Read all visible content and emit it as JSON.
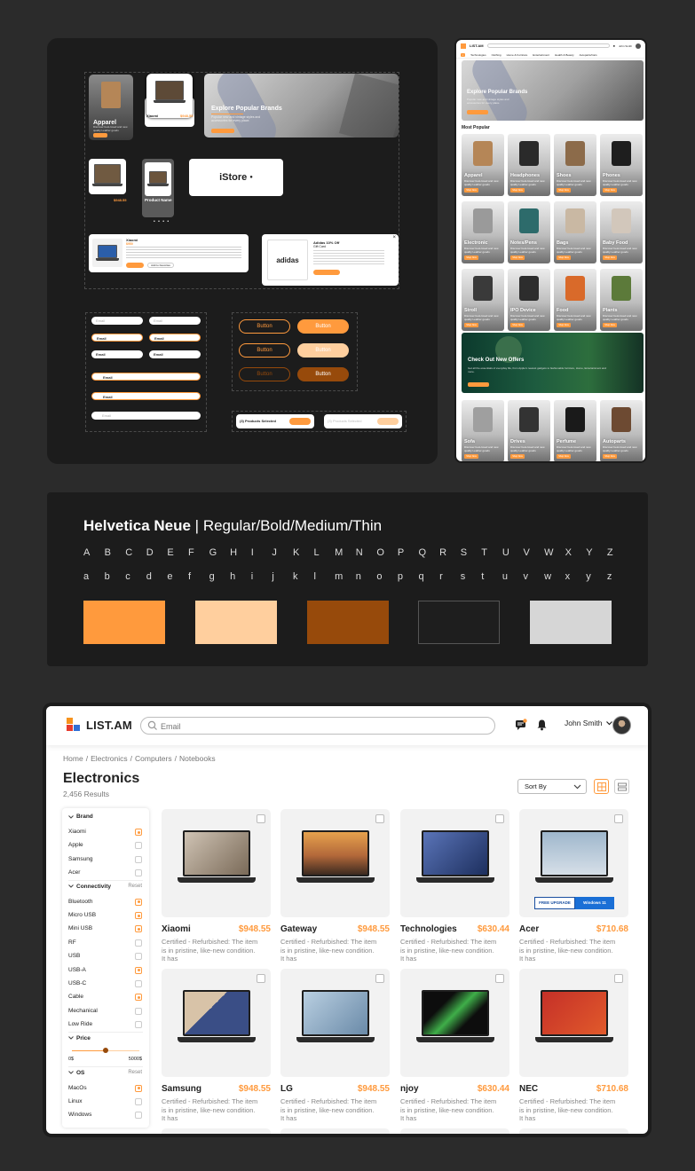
{
  "board": {
    "apparel_title": "Apparel",
    "apparel_sub": "Discover best-loved and new quality Leather goods",
    "xiaomi_label": "Xiaomi",
    "xiaomi_price": "$948.55",
    "hero_title": "Explore Popular Brands",
    "hero_sub": "Popular new and vintage styles and accessories for every place.",
    "product_price": "$948.55",
    "product_name_label": "Product Name",
    "istore_logo": "iStore",
    "promo_brand": "Xiaomi",
    "promo_price": "$950",
    "promo_add": "Add to Favorites",
    "adidas_title": "Adidas 10% Off",
    "adidas_sub": "Gift Card",
    "adidas_logo": "adidas",
    "inputs": {
      "email_placeholder": "Email",
      "email_value": "Email"
    },
    "button_label": "Button",
    "products_selected": "(3) Products Selected",
    "products_selected_grey": "(3) Products Selected"
  },
  "preview": {
    "logo": "LIST.AM",
    "user": "John Smith",
    "nav": [
      "Technologies",
      "Clothing",
      "Home & Furniture",
      "Entertainment",
      "Health & Beauty",
      "Autoparts/Cars"
    ],
    "hero_title": "Explore Popular Brands",
    "hero_sub": "Popular new and vintage styles and accessories for every place.",
    "most_popular": "Most Popular",
    "card_sub": "Discover best-loved and new quality Leather goods",
    "card_btn": "Shop Now",
    "cards": [
      "Apparel",
      "Headphones",
      "Shoes",
      "Phones",
      "Electronic",
      "Notes/Pens",
      "Bags",
      "Baby Food",
      "Stroll",
      "IPO Device",
      "Food",
      "Plants",
      "Sofa",
      "Drives",
      "Perfume",
      "Autoparts"
    ],
    "offer_title": "Check Out  New Offers",
    "offer_sub": "Get all the essentials of everyday life, from Apple's newest gadgets to fashionable furniture, Home, Entertainment and more.",
    "offer_btn": "Shop Now"
  },
  "typography": {
    "font_name": "Helvetica Neue",
    "weights": " | Regular/Bold/Medium/Thin",
    "upper": [
      "A",
      "B",
      "C",
      "D",
      "E",
      "F",
      "G",
      "H",
      "I",
      "J",
      "K",
      "L",
      "M",
      "N",
      "O",
      "P",
      "Q",
      "R",
      "S",
      "T",
      "U",
      "V",
      "W",
      "X",
      "Y",
      "Z"
    ],
    "lower": [
      "a",
      "b",
      "c",
      "d",
      "e",
      "f",
      "g",
      "h",
      "i",
      "j",
      "k",
      "l",
      "m",
      "n",
      "o",
      "p",
      "q",
      "r",
      "s",
      "t",
      "u",
      "v",
      "w",
      "x",
      "y",
      "z"
    ],
    "palette": [
      "#ff9a3d",
      "#ffcf9e",
      "#974a0b",
      "#1e1e1e",
      "#d6d6d6"
    ]
  },
  "app": {
    "logo": "LIST.AM",
    "search_placeholder": "Email",
    "user_name": "John Smith",
    "breadcrumbs": [
      "Home",
      "Electronics",
      "Computers",
      "Notebooks"
    ],
    "title": "Electronics",
    "results": "2,456 Results",
    "sort_label": "Sort By",
    "filters": {
      "brand_label": "Brand",
      "brands": [
        {
          "name": "Xiaomi",
          "checked": true
        },
        {
          "name": "Apple",
          "checked": false
        },
        {
          "name": "Samsung",
          "checked": false
        },
        {
          "name": "Acer",
          "checked": false
        }
      ],
      "connectivity_label": "Connectivity",
      "reset": "Reset",
      "connectivity": [
        {
          "name": "Bluetooth",
          "checked": true
        },
        {
          "name": "Micro USB",
          "checked": true
        },
        {
          "name": "Mini USB",
          "checked": true
        },
        {
          "name": "RF",
          "checked": false
        },
        {
          "name": "USB",
          "checked": false
        },
        {
          "name": "USB-A",
          "checked": true
        },
        {
          "name": "USB-C",
          "checked": false
        },
        {
          "name": "Cable",
          "checked": true
        },
        {
          "name": "Mechanical",
          "checked": false
        },
        {
          "name": "Low Ride",
          "checked": false
        }
      ],
      "price_label": "Price",
      "price_min": "0$",
      "price_max": "5000$",
      "price_level": 0.5,
      "os_label": "OS",
      "os": [
        {
          "name": "MacOs",
          "checked": true
        },
        {
          "name": "Linux",
          "checked": false
        },
        {
          "name": "Windows",
          "checked": false
        }
      ]
    },
    "desc": "Certified - Refurbished: The item is in pristine, like-new condition. It has",
    "products": [
      {
        "name": "Xiaomi",
        "price": "$948.55"
      },
      {
        "name": "Gateway",
        "price": "$948.55"
      },
      {
        "name": "Technologies",
        "price": "$630.44"
      },
      {
        "name": "Acer",
        "price": "$710.68"
      },
      {
        "name": "Samsung",
        "price": "$948.55"
      },
      {
        "name": "LG",
        "price": "$948.55"
      },
      {
        "name": "njoy",
        "price": "$630.44"
      },
      {
        "name": "NEC",
        "price": "$710.68"
      }
    ],
    "acer_badge_left": "FREE UPGRADE",
    "acer_badge_right": "Windows 11"
  }
}
